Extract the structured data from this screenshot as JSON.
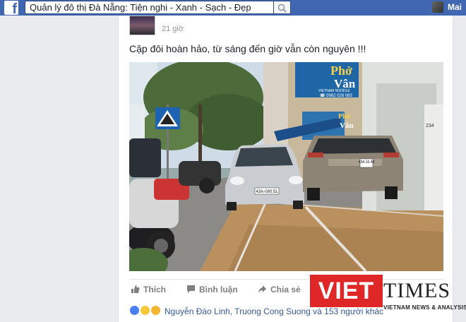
{
  "topbar": {
    "logo_letter": "f",
    "search_value": "Quản lý đô thị Đà Nẵng: Tiện nghi - Xanh - Sạch - Đẹp",
    "user_name": "Mai"
  },
  "post": {
    "time": "21 giờ",
    "text": "Cặp đôi hoàn hảo, từ sáng đến giờ vẫn còn nguyên !!!",
    "photo": {
      "sign_top": "Phở",
      "sign_main": "Vân",
      "sign_tag": "VIETNAM NOODLE",
      "sign_phone": "☎ 0982 026 083",
      "sign_small_top": "Phở",
      "sign_small_main": "Vân",
      "house_number": "234",
      "plate_silver": "43A-080.51",
      "plate_brown": "43A\n16.48"
    },
    "actions": {
      "like": "Thích",
      "comment": "Bình luận",
      "share": "Chia sẻ"
    },
    "reactions": {
      "names": "Nguyễn Đào Linh, Truong Cong Suong và 153 người khác"
    }
  },
  "watermark": {
    "viet": "VIET",
    "times": "TIMES",
    "subtitle": "VIETNAM NEWS & ANALYSIS"
  },
  "colors": {
    "facebook_blue": "#4267b2",
    "link_blue": "#365899",
    "watermark_red": "#e02727"
  }
}
